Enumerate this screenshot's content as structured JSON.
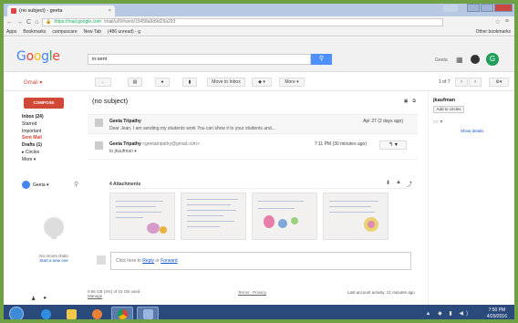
{
  "browser": {
    "tab_title": "(no subject) - geeta",
    "tab_close": "×",
    "url_host": "https://mail.google.com",
    "url_path": "/mail/u/0/#sent/15458a9d9d29a293",
    "back": "←",
    "forward": "→",
    "reload": "C",
    "home": "⌂",
    "bookmarks": [
      "Apps",
      "Bookmarks",
      "campuscare",
      "New Tab",
      "(486 unread) - g"
    ],
    "other_bookmarks": "Other bookmarks"
  },
  "gmail": {
    "logo_letters": [
      "G",
      "o",
      "o",
      "g",
      "l",
      "e"
    ],
    "search_value": "in:sent",
    "search_button_icon": "search-icon",
    "user_name": "Geeta",
    "avatar_letter": "G",
    "label": "Gmail ▾",
    "toolbar": {
      "move_to_inbox": "Move to Inbox",
      "more": "More ▾",
      "pager": "1 of 7"
    },
    "compose": "COMPOSE",
    "nav": [
      {
        "label": "Inbox (24)",
        "style": "bold"
      },
      {
        "label": "Starred",
        "style": ""
      },
      {
        "label": "Important",
        "style": ""
      },
      {
        "label": "Sent Mail",
        "style": "red"
      },
      {
        "label": "Drafts (1)",
        "style": "bold"
      },
      {
        "label": "▸ Circles",
        "style": ""
      },
      {
        "label": "More ▾",
        "style": ""
      }
    ],
    "hangout_user": "Geeta ▾",
    "no_chats": "No recent chats",
    "start_chat": "Start a new one",
    "subject": "(no subject)",
    "messages": [
      {
        "sender": "Geeta Tripathy",
        "snippet": "Dear Jean, I am sending my students work You can show it to your students and...",
        "date": "Apr 27 (2 days ago)"
      },
      {
        "sender": "Geeta Tripathy",
        "email": "<geetatripathy@gmail.com>",
        "to": "to jkaufman ▾",
        "date": "7:11 PM (30 minutes ago)"
      }
    ],
    "attachments_label": "4 Attachments",
    "reply_prompt_prefix": "Click here to ",
    "reply_link": "Reply",
    "reply_mid": " or ",
    "forward_link": "Forward",
    "storage": "0.66 GB (4%) of 15 GB used",
    "manage": "Manage",
    "terms": "Terms - Privacy",
    "activity": "Last account activity: 21 minutes ago",
    "right_pane": {
      "name": "jkaufman",
      "add_circles": "Add to circles",
      "show_details": "Show details"
    }
  },
  "taskbar": {
    "time": "7:50 PM",
    "date": "4/29/2016"
  },
  "colors": {
    "accent_red": "#d14836",
    "search_blue": "#4d90fe",
    "frame_green": "#6fa043",
    "taskbar": "#2b4a7c"
  }
}
